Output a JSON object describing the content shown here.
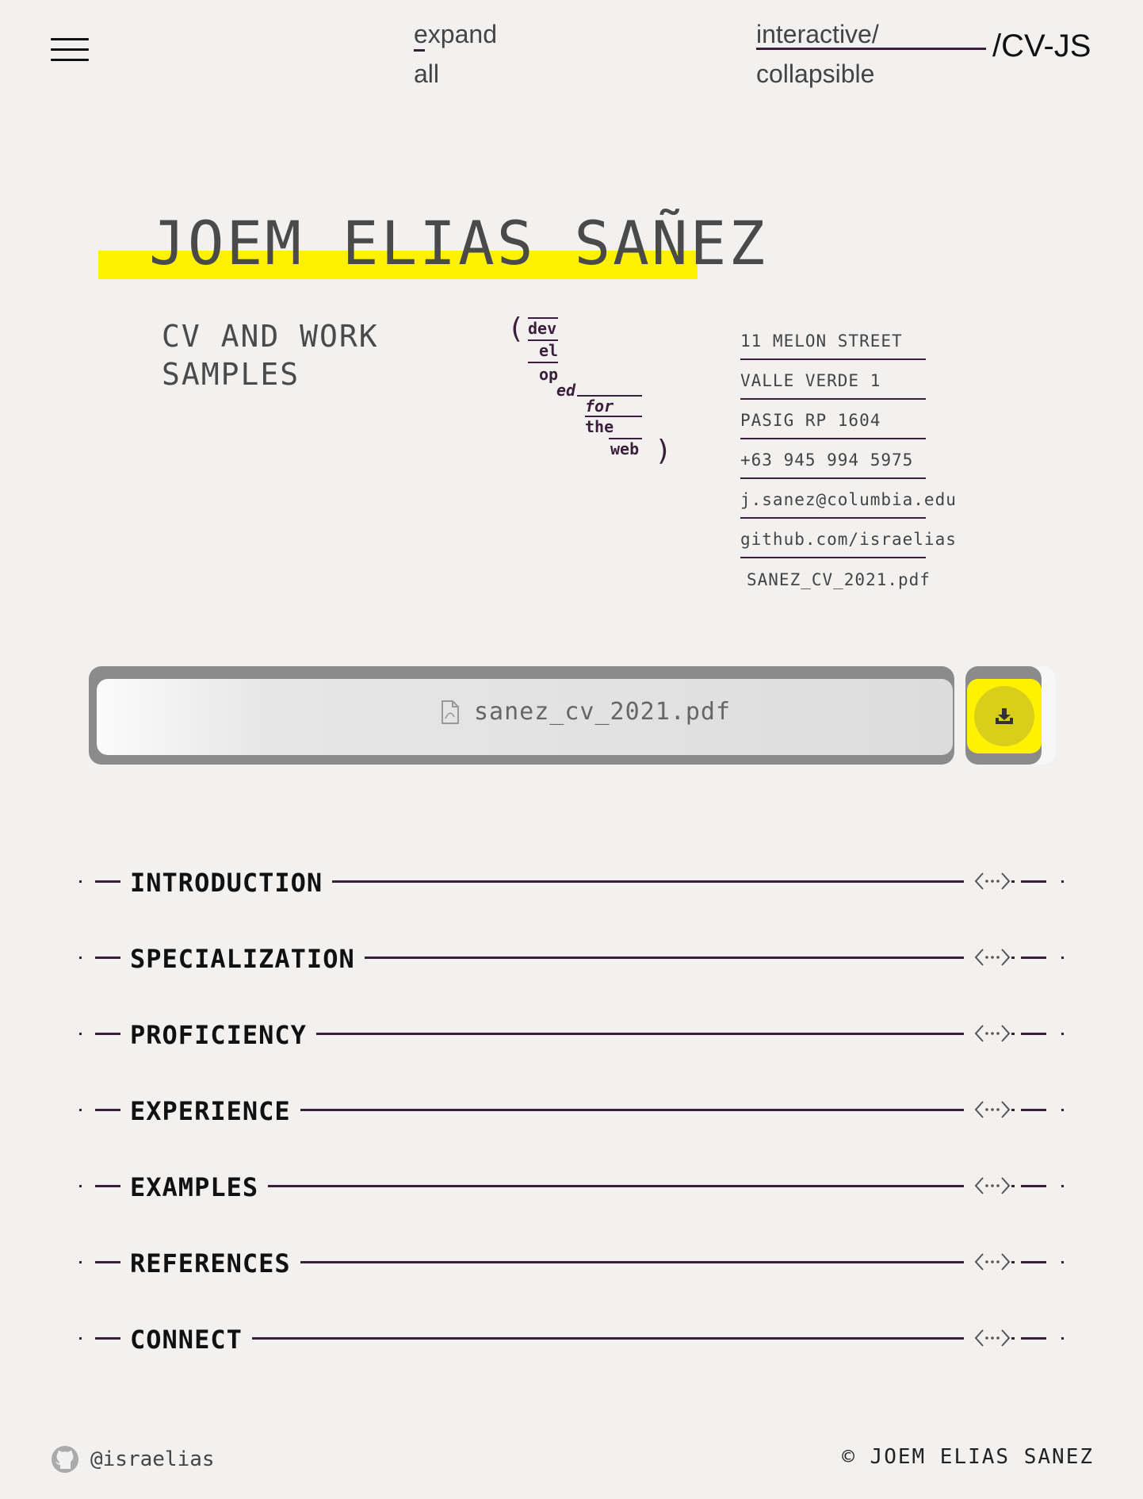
{
  "header": {
    "expand_line1": "expand",
    "expand_line2": "all",
    "interactive_line1": "interactive/",
    "interactive_line2": "collapsible",
    "brand": "/CV-JS"
  },
  "hero": {
    "name": "JOEM ELIAS SAÑEZ",
    "subtitle_line1": "CV AND WORK",
    "subtitle_line2": "SAMPLES",
    "tagline": {
      "open": "(",
      "w1": "dev",
      "w2": "el",
      "w3": "op",
      "w4": "ed",
      "w5": "for",
      "w6": "the",
      "w7": "web",
      "close": ")"
    }
  },
  "contacts": {
    "street": "11 MELON STREET",
    "district": "VALLE VERDE 1",
    "city": "PASIG RP 1604",
    "phone": "+63 945 994 5975",
    "email": "j.sanez@columbia.edu",
    "github": "github.com/israelias",
    "pdf": "SANEZ_CV_2021.pdf"
  },
  "download": {
    "filename": "sanez_cv_2021.pdf",
    "accent": "#fff200"
  },
  "sections": [
    {
      "label": "INTRODUCTION"
    },
    {
      "label": "SPECIALIZATION"
    },
    {
      "label": "PROFICIENCY"
    },
    {
      "label": "EXPERIENCE"
    },
    {
      "label": "EXAMPLES"
    },
    {
      "label": "REFERENCES"
    },
    {
      "label": "CONNECT"
    }
  ],
  "footer": {
    "handle": "@israelias",
    "copyright": "© JOEM ELIAS SANEZ"
  },
  "icons": {
    "menu": "hamburger-icon",
    "pdf": "pdf-file-icon",
    "download": "download-icon",
    "toggle": "expand-collapse-icon",
    "github": "github-icon"
  }
}
